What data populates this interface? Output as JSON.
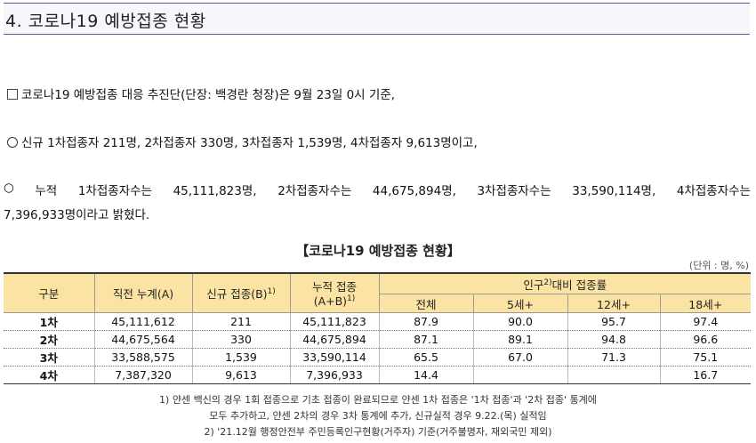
{
  "header": {
    "title": "4. 코로나19 예방접종 현황"
  },
  "paragraphs": {
    "p1": "코로나19 예방접종 대응 추진단(단장: 백경란 청장)은 9월 23일 0시 기준,",
    "p2": "신규 1차접종자 211명, 2차접종자 330명, 3차접종자 1,539명, 4차접종자 9,613명이고,",
    "p3_words": [
      "○",
      "누적",
      "1차접종자수는",
      "45,111,823명,",
      "2차접종자수는",
      "44,675,894명,",
      "3차접종자수는",
      "33,590,114명,",
      "4차접종자수는"
    ],
    "p3_cont": "7,396,933명이라고 밝혔다."
  },
  "table": {
    "title": "【코로나19 예방접종 현황】",
    "unit": "(단위 : 명, %)",
    "headers": {
      "gubun": "구분",
      "prev": "직전 누계(A)",
      "new": "신규 접종(B)",
      "new_sup": "1)",
      "cum_line1": "누적 접종",
      "cum_line2": "(A+B)",
      "cum_sup": "1)",
      "pop_pre": "인구",
      "pop_sup": "2)",
      "pop_post": "대비 접종률",
      "total": "전체",
      "age5": "5세+",
      "age12": "12세+",
      "age18": "18세+"
    },
    "rows": [
      {
        "label": "1차",
        "prev": "45,111,612",
        "new": "211",
        "cum": "45,111,823",
        "total": "87.9",
        "age5": "90.0",
        "age12": "95.7",
        "age18": "97.4"
      },
      {
        "label": "2차",
        "prev": "44,675,564",
        "new": "330",
        "cum": "44,675,894",
        "total": "87.1",
        "age5": "89.1",
        "age12": "94.8",
        "age18": "96.6"
      },
      {
        "label": "3차",
        "prev": "33,588,575",
        "new": "1,539",
        "cum": "33,590,114",
        "total": "65.5",
        "age5": "67.0",
        "age12": "71.3",
        "age18": "75.1"
      },
      {
        "label": "4차",
        "prev": "7,387,320",
        "new": "9,613",
        "cum": "7,396,933",
        "total": "14.4",
        "age5": "",
        "age12": "",
        "age18": "16.7"
      }
    ]
  },
  "footnotes": {
    "f1": "1) 얀센 백신의 경우 1회 접종으로 기초 접종이 완료되므로 얀센 1차 접종은 '1차 접종'과 '2차 접종' 통계에",
    "f2": "모두 추가하고, 얀센 2차의 경우 3차 통계에 추가, 신규실적 경우 9.22.(목) 실적임",
    "f3": "2) '21.12월 행정안전부 주민등록인구현황(거주자) 기준(거주불명자, 재외국민 제외)"
  }
}
